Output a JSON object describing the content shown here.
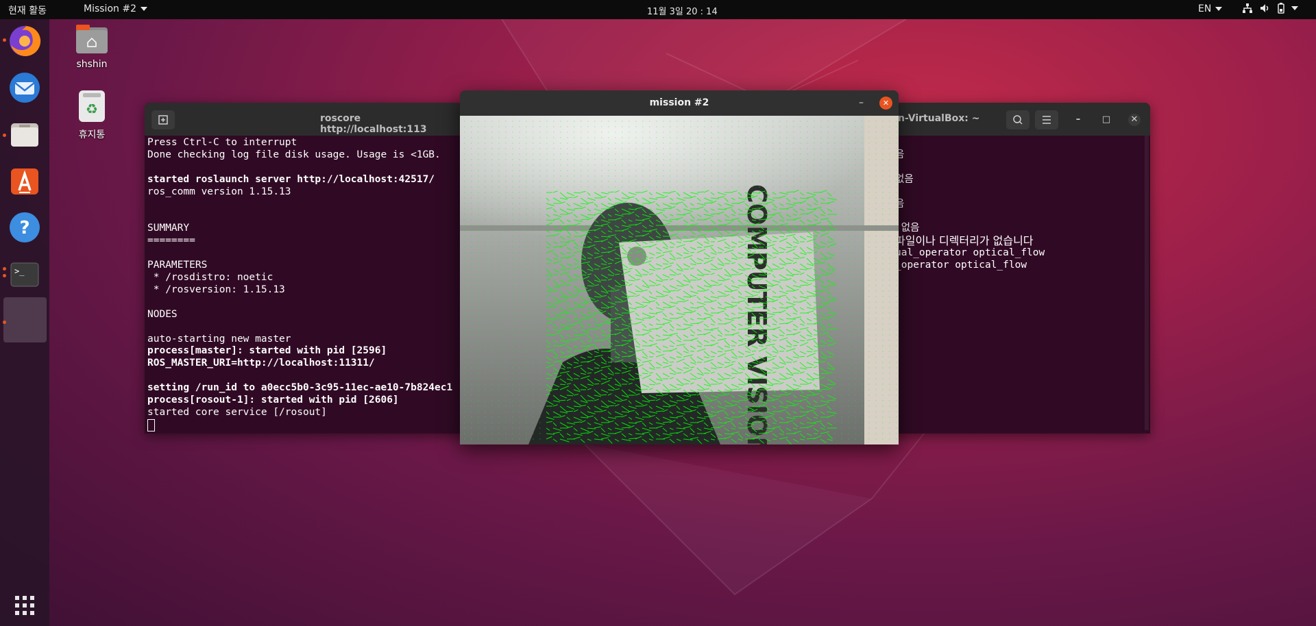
{
  "topbar": {
    "activities": "현재 활동",
    "app_menu": "Mission #2",
    "clock": "11월 3일  20 : 14",
    "language": "EN"
  },
  "desktop": {
    "home_label": "shshin",
    "trash_label": "휴지통"
  },
  "dock": {
    "items": [
      "firefox-icon",
      "thunderbird-icon",
      "files-icon",
      "software-icon",
      "help-icon",
      "terminal-icon",
      "opencv-window-icon"
    ],
    "show_apps": "show-applications-icon"
  },
  "terminal_left": {
    "title": "roscore http://localhost:113",
    "lines": [
      {
        "text": "Press Ctrl-C to interrupt",
        "bold": false
      },
      {
        "text": "Done checking log file disk usage. Usage is <1GB.",
        "bold": false
      },
      {
        "text": "",
        "bold": false
      },
      {
        "text": "started roslaunch server http://localhost:42517/",
        "bold": true
      },
      {
        "text": "ros_comm version 1.15.13",
        "bold": false
      },
      {
        "text": "",
        "bold": false
      },
      {
        "text": "",
        "bold": false
      },
      {
        "text": "SUMMARY",
        "bold": false
      },
      {
        "text": "========",
        "bold": false
      },
      {
        "text": "",
        "bold": false
      },
      {
        "text": "PARAMETERS",
        "bold": false
      },
      {
        "text": " * /rosdistro: noetic",
        "bold": false
      },
      {
        "text": " * /rosversion: 1.15.13",
        "bold": false
      },
      {
        "text": "",
        "bold": false
      },
      {
        "text": "NODES",
        "bold": false
      },
      {
        "text": "",
        "bold": false
      },
      {
        "text": "auto-starting new master",
        "bold": false
      },
      {
        "text": "process[master]: started with pid [2596]",
        "bold": true
      },
      {
        "text": "ROS_MASTER_URI=http://localhost:11311/",
        "bold": true
      },
      {
        "text": "",
        "bold": false
      },
      {
        "text": "setting /run_id to a0ecc5b0-3c95-11ec-ae10-7b824ec1",
        "bold": true
      },
      {
        "text": "process[rosout-1]: started with pid [2606]",
        "bold": true
      },
      {
        "text": "started core service [/rosout]",
        "bold": false
      }
    ]
  },
  "terminal_right": {
    "title": "n-VirtualBox: ~",
    "lines": [
      "",
      "음",
      "",
      "없음",
      "",
      "음",
      "",
      " 없음",
      "파일이나 디렉터리가 없습니다",
      "ual_operator optical_flow",
      "_operator optical_flow"
    ]
  },
  "mission_window": {
    "title": "mission #2",
    "sign_text": "COMPUTER VISION"
  },
  "colors": {
    "accent": "#e95420",
    "terminal_bg": "#300a24",
    "flow_green": "#00ff00"
  }
}
